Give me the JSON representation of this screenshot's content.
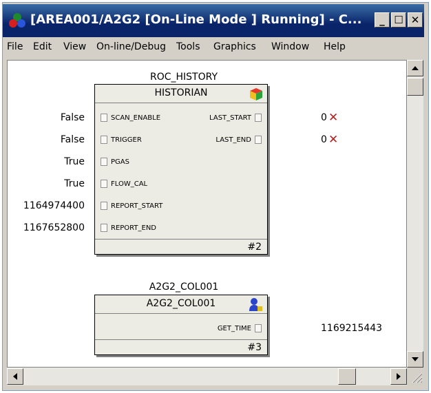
{
  "window": {
    "title": "[AREA001/A2G2 [On-Line Mode ] Running] - C...",
    "min_label": "_",
    "max_label": "☐",
    "close_label": "✕"
  },
  "menu": {
    "items": [
      "File",
      "Edit",
      "View",
      "On-line/Debug",
      "Tools",
      "Graphics",
      "Window",
      "Help"
    ]
  },
  "block1": {
    "instance_name": "ROC_HISTORY",
    "type_name": "HISTORIAN",
    "number": "#2",
    "inputs": [
      {
        "pin": "SCAN_ENABLE",
        "value": "False"
      },
      {
        "pin": "TRIGGER",
        "value": "False"
      },
      {
        "pin": "PGAS",
        "value": "True"
      },
      {
        "pin": "FLOW_CAL",
        "value": "True"
      },
      {
        "pin": "REPORT_START",
        "value": "1164974400"
      },
      {
        "pin": "REPORT_END",
        "value": "1167652800"
      }
    ],
    "outputs": [
      {
        "pin": "LAST_START",
        "value": "0"
      },
      {
        "pin": "LAST_END",
        "value": "0"
      }
    ]
  },
  "block2": {
    "instance_name": "A2G2_COL001",
    "type_name": "A2G2_COL001",
    "number": "#3",
    "outputs": [
      {
        "pin": "GET_TIME",
        "value": "1169215443"
      }
    ]
  },
  "icons": {
    "app": "network-nodes-icon",
    "historian": "cube-icon",
    "collector": "user-block-icon",
    "error": "x-mark-icon"
  },
  "colors": {
    "titlebar": "#0a246a",
    "error_x": "#b22222",
    "block_fill": "#ecebe4"
  }
}
